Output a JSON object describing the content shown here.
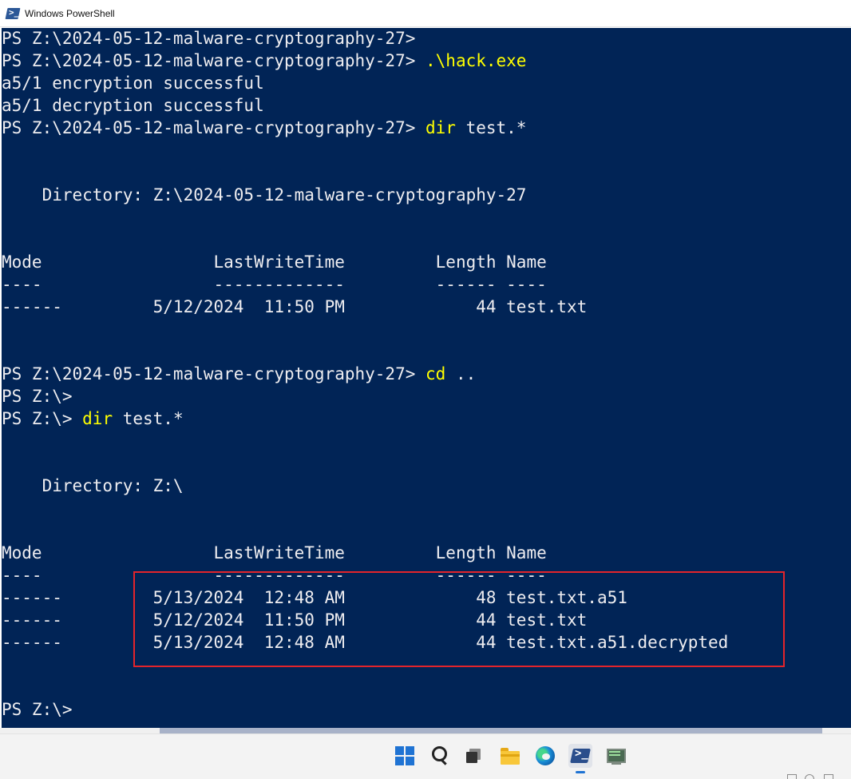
{
  "window": {
    "title": "Windows PowerShell"
  },
  "console": {
    "lines": [
      {
        "segments": [
          {
            "text": "PS Z:\\2024-05-12-malware-cryptography-27>",
            "cmd": false
          }
        ]
      },
      {
        "segments": [
          {
            "text": "PS Z:\\2024-05-12-malware-cryptography-27> ",
            "cmd": false
          },
          {
            "text": ".\\hack.exe",
            "cmd": true
          }
        ]
      },
      {
        "segments": [
          {
            "text": "a5/1 encryption successful",
            "cmd": false
          }
        ]
      },
      {
        "segments": [
          {
            "text": "a5/1 decryption successful",
            "cmd": false
          }
        ]
      },
      {
        "segments": [
          {
            "text": "PS Z:\\2024-05-12-malware-cryptography-27> ",
            "cmd": false
          },
          {
            "text": "dir",
            "cmd": true
          },
          {
            "text": " test.*",
            "cmd": false
          }
        ]
      },
      {
        "segments": []
      },
      {
        "segments": []
      },
      {
        "segments": [
          {
            "text": "    Directory: Z:\\2024-05-12-malware-cryptography-27",
            "cmd": false
          }
        ]
      },
      {
        "segments": []
      },
      {
        "segments": []
      },
      {
        "segments": [
          {
            "text": "Mode                 LastWriteTime         Length Name",
            "cmd": false
          }
        ]
      },
      {
        "segments": [
          {
            "text": "----                 -------------         ------ ----",
            "cmd": false
          }
        ]
      },
      {
        "segments": [
          {
            "text": "------         5/12/2024  11:50 PM             44 test.txt",
            "cmd": false
          }
        ]
      },
      {
        "segments": []
      },
      {
        "segments": []
      },
      {
        "segments": [
          {
            "text": "PS Z:\\2024-05-12-malware-cryptography-27> ",
            "cmd": false
          },
          {
            "text": "cd",
            "cmd": true
          },
          {
            "text": " ..",
            "cmd": false
          }
        ]
      },
      {
        "segments": [
          {
            "text": "PS Z:\\>",
            "cmd": false
          }
        ]
      },
      {
        "segments": [
          {
            "text": "PS Z:\\> ",
            "cmd": false
          },
          {
            "text": "dir",
            "cmd": true
          },
          {
            "text": " test.*",
            "cmd": false
          }
        ]
      },
      {
        "segments": []
      },
      {
        "segments": []
      },
      {
        "segments": [
          {
            "text": "    Directory: Z:\\",
            "cmd": false
          }
        ]
      },
      {
        "segments": []
      },
      {
        "segments": []
      },
      {
        "segments": [
          {
            "text": "Mode                 LastWriteTime         Length Name",
            "cmd": false
          }
        ]
      },
      {
        "segments": [
          {
            "text": "----                 -------------         ------ ----",
            "cmd": false
          }
        ]
      },
      {
        "segments": [
          {
            "text": "------         5/13/2024  12:48 AM             48 test.txt.a51",
            "cmd": false
          }
        ]
      },
      {
        "segments": [
          {
            "text": "------         5/12/2024  11:50 PM             44 test.txt",
            "cmd": false
          }
        ]
      },
      {
        "segments": [
          {
            "text": "------         5/13/2024  12:48 AM             44 test.txt.a51.decrypted",
            "cmd": false
          }
        ]
      },
      {
        "segments": []
      },
      {
        "segments": []
      },
      {
        "segments": [
          {
            "text": "PS Z:\\>",
            "cmd": false
          }
        ]
      }
    ]
  },
  "colors": {
    "console_bg": "#012456",
    "console_text": "#eeedf0",
    "command_text": "#ffff00",
    "highlight_border": "#e3242b"
  },
  "taskbar": {
    "icons": [
      "windows-start-icon",
      "search-icon",
      "task-view-icon",
      "file-explorer-icon",
      "edge-browser-icon",
      "powershell-icon",
      "terminal-monitor-icon"
    ],
    "active": "powershell-icon"
  }
}
